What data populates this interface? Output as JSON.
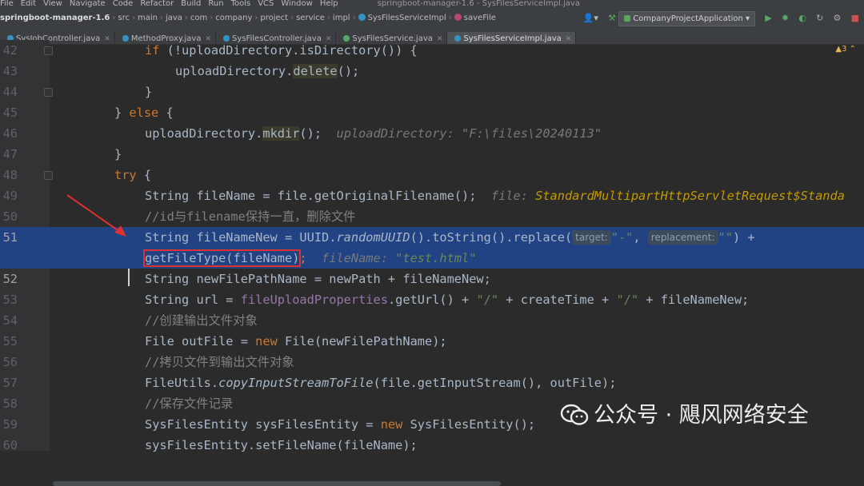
{
  "menu": [
    "File",
    "Edit",
    "View",
    "Navigate",
    "Code",
    "Refactor",
    "Build",
    "Run",
    "Tools",
    "VCS",
    "Window",
    "Help"
  ],
  "window_title": "springboot-manager-1.6 - SysFilesServiceImpl.java",
  "breadcrumbs": [
    "springboot-manager-1.6",
    "src",
    "main",
    "java",
    "com",
    "company",
    "project",
    "service",
    "impl",
    "SysFilesServiceImpl",
    "saveFile"
  ],
  "run_config": "CompanyProjectApplication",
  "tabs": [
    "SysJobController.java",
    "MethodProxy.java",
    "SysFilesController.java",
    "SysFilesService.java",
    "SysFilesServiceImpl.java"
  ],
  "active_tab": "SysFilesServiceImpl.java",
  "warning_count": "3",
  "line_numbers": [
    "42",
    "43",
    "44",
    "45",
    "46",
    "47",
    "48",
    "49",
    "50",
    "51",
    "",
    "52",
    "53",
    "54",
    "55",
    "56",
    "57",
    "58",
    "59",
    "60"
  ],
  "code": {
    "l42_a": "if (!uploadDirectory.isDirectory()) {",
    "l43_a": "uploadDirectory.",
    "l43_b": "delete",
    "l43_c": "();",
    "l44": "}",
    "l45_a": "} ",
    "l45_b": "else",
    "l45_c": " {",
    "l46_a": "uploadDirectory.",
    "l46_b": "mkdir",
    "l46_c": "();",
    "l46_hint": "uploadDirectory: \"F:\\files\\20240113\"",
    "l47": "}",
    "l48_a": "try",
    "l48_b": " {",
    "l49_a": "String fileName = file.getOriginalFilename();",
    "l49_hint_a": "file: ",
    "l49_hint_b": "StandardMultipartHttpServletRequest$Standa",
    "l50": "//id与filename保持一直，删除文件",
    "l51_a": "String fileNameNew = UUID.",
    "l51_b": "randomUUID",
    "l51_c": "().toString().replace(",
    "l51_ph1": "target:",
    "l51_s1": "\"-\"",
    "l51_d": ", ",
    "l51_ph2": "replacement:",
    "l51_s2": "\"\"",
    "l51_e": ") +",
    "l51w_a": "getFileType(fileName)",
    "l51w_b": ";",
    "l51w_hint_a": "fileName: ",
    "l51w_hint_b": "\"test.html\"",
    "l52": "String newFilePathName = newPath + fileNameNew;",
    "l53_a": "String url = ",
    "l53_b": "fileUploadProperties",
    "l53_c": ".getUrl() + ",
    "l53_d": "\"/\"",
    "l53_e": " + createTime + ",
    "l53_f": "\"/\"",
    "l53_g": " + fileNameNew;",
    "l54": "//创建输出文件对象",
    "l55_a": "File outFile = ",
    "l55_b": "new",
    "l55_c": " File(newFilePathName);",
    "l56": "//拷贝文件到输出文件对象",
    "l57_a": "FileUtils.",
    "l57_b": "copyInputStreamToFile",
    "l57_c": "(file.getInputStream(), outFile);",
    "l58": "//保存文件记录",
    "l59_a": "SysFilesEntity sysFilesEntity = ",
    "l59_b": "new",
    "l59_c": " SysFilesEntity();",
    "l60": "sysFilesEntity.setFileName(fileName);"
  },
  "watermark": "公众号 · 飓风网络安全",
  "colors": {
    "selection": "#214283",
    "annotation_red": "#e03131",
    "keyword": "#cc7832",
    "string": "#6a8759"
  }
}
